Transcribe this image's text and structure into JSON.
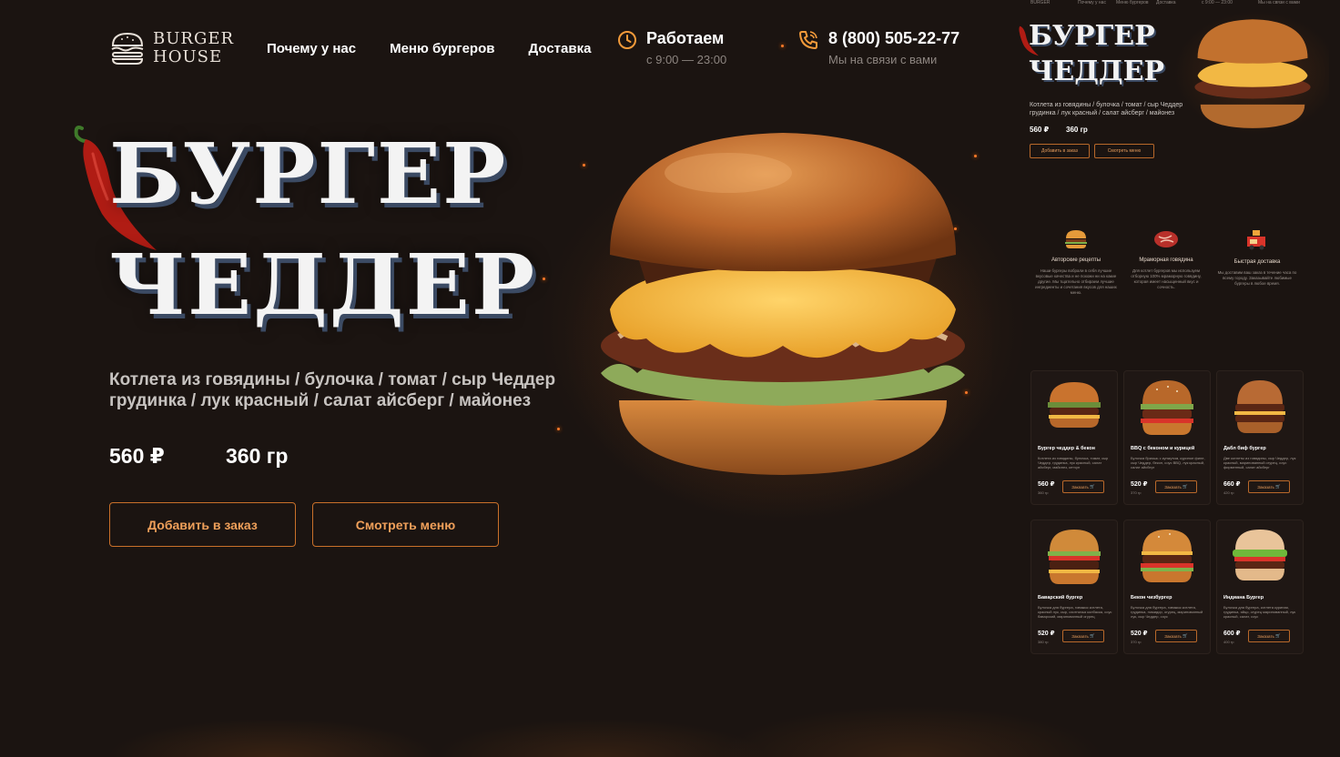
{
  "header": {
    "logo_line1": "BURGER",
    "logo_line2": "HOUSE",
    "nav": [
      "Почему у нас",
      "Меню бургеров",
      "Доставка"
    ],
    "hours_title": "Работаем",
    "hours_value": "с 9:00 — 23:00",
    "phone": "8 (800) 505-22-77",
    "phone_note": "Мы на связи с вами"
  },
  "hero": {
    "title_line1": "БУРГЕР",
    "title_line2": "ЧЕДДЕР",
    "desc_line1": "Котлета из говядины / булочка / томат / сыр Чеддер",
    "desc_line2": "грудинка / лук красный / салат айсберг / майонез",
    "price": "560 ₽",
    "weight": "360 гр",
    "btn_add": "Добавить в заказ",
    "btn_menu": "Смотреть меню"
  },
  "preview": {
    "title_line1": "БУРГЕР",
    "title_line2": "ЧЕДДЕР",
    "desc_line1": "Котлета из говядины / булочка / томат / сыр Чеддер",
    "desc_line2": "грудинка / лук красный / салат айсберг / майонез",
    "price": "560 ₽",
    "weight": "360 гр",
    "btn_add": "Добавить в заказ",
    "btn_menu": "Смотреть меню",
    "features": [
      {
        "title": "Авторские рецепты",
        "text": "Наши бургеры вобрали в себя лучшие вкусовые качества и не похожи ни на какие другие. Мы тщательно отбираем лучшие ингредиенты и сочетания вкусов для наших меню."
      },
      {
        "title": "Мраморная говядина",
        "text": "Для котлет бургеров мы используем отборную 100% мраморную говядину, которая имеет насыщенный вкус и сочность."
      },
      {
        "title": "Быстрая доставка",
        "text": "Мы доставим ваш заказ в течение часа по всему городу. Заказывайте любимые бургеры в любое время."
      }
    ],
    "cards": [
      {
        "name": "Бургер чеддер & бекон",
        "desc": "Котлета из говядины, булочка, томат, сыр Чеддер, грудинка, лук красный, салат айсберг, майонез, кетчуп",
        "price": "560 ₽",
        "weight": "360 гр",
        "btn": "Заказать"
      },
      {
        "name": "BBQ с беконом и курицей",
        "desc": "Булочка бриошь с кунжутом, куриное филе, сыр Чеддер, бекон, соус BBQ, лук красный, салат айсберг",
        "price": "520 ₽",
        "weight": "370 гр",
        "btn": "Заказать"
      },
      {
        "name": "Дабл биф бургер",
        "desc": "Две котлеты из говядины, сыр Чеддер, лук красный, маринованный огурец, соус фирменный, салат айсберг",
        "price": "660 ₽",
        "weight": "420 гр",
        "btn": "Заказать"
      },
      {
        "name": "Баварский бургер",
        "desc": "Булочка для бургера, говяжья котлета, красный лук, сыр, охотничья колбаска, соус баварский, маринованный огурец",
        "price": "520 ₽",
        "weight": "380 гр",
        "btn": "Заказать"
      },
      {
        "name": "Бекон чизбургер",
        "desc": "Булочка для бургера, говяжья котлета, грудинка, помидор, огурец, маринованный лук, сыр Чеддер, соус",
        "price": "520 ₽",
        "weight": "370 гр",
        "btn": "Заказать"
      },
      {
        "name": "Индиана Бургер",
        "desc": "Булочка для бургера, котлета куриная, грудинка, яйцо, огурец маринованный, лук красный, салат, соус",
        "price": "600 ₽",
        "weight": "400 гр",
        "btn": "Заказать"
      }
    ]
  },
  "colors": {
    "background": "#1b1411",
    "accent": "#c9702a",
    "accent_text": "#f0a05a"
  },
  "icons": [
    "burger-logo-icon",
    "clock-icon",
    "phone-icon",
    "chili-icon",
    "cart-icon"
  ]
}
